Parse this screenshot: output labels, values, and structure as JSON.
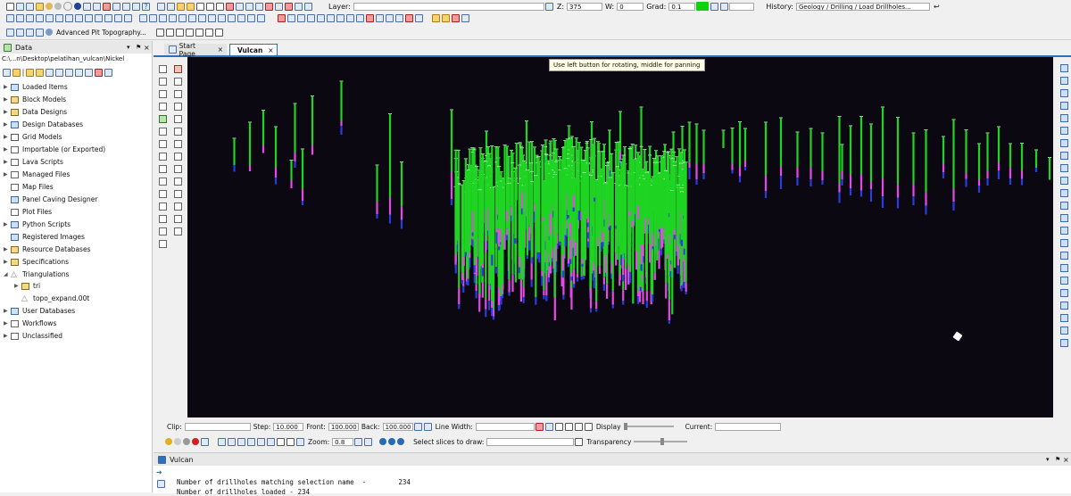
{
  "toolbar": {
    "layer_label": "Layer:",
    "z_label": "Z:",
    "z_value": "375",
    "w_label": "W:",
    "w_value": "0",
    "grad_label": "Grad:",
    "grad_value": "0.1",
    "history_label": "History:",
    "history_value": "Geology / Drilling / Load Drillholes...",
    "advanced_pit_label": "Advanced Pit Topography..."
  },
  "data_panel": {
    "title": "Data",
    "pin_icon": "pin-icon",
    "path": "C:\\...n\\Desktop\\pelatihan_vulcan\\Nickel",
    "items": [
      {
        "label": "Loaded Items",
        "icon": "layers-icon"
      },
      {
        "label": "Block Models",
        "icon": "folder-icon"
      },
      {
        "label": "Data Designs",
        "icon": "folder-icon"
      },
      {
        "label": "Design Databases",
        "icon": "database-icon"
      },
      {
        "label": "Grid Models",
        "icon": "grid-icon"
      },
      {
        "label": "Importable (or Exported)",
        "icon": "file-icon"
      },
      {
        "label": "Lava Scripts",
        "icon": "file-icon"
      },
      {
        "label": "Managed Files",
        "icon": "file-icon"
      },
      {
        "label": "Map Files",
        "icon": "map-icon"
      },
      {
        "label": "Panel Caving Designer",
        "icon": "panel-icon"
      },
      {
        "label": "Plot Files",
        "icon": "plot-icon"
      },
      {
        "label": "Python Scripts",
        "icon": "python-icon"
      },
      {
        "label": "Registered Images",
        "icon": "image-icon"
      },
      {
        "label": "Resource Databases",
        "icon": "folder-icon"
      },
      {
        "label": "Specifications",
        "icon": "folder-icon"
      },
      {
        "label": "Triangulations",
        "icon": "triangle-icon"
      },
      {
        "label": "tri",
        "icon": "folder-icon"
      },
      {
        "label": "topo_expand.00t",
        "icon": "triangle-icon"
      },
      {
        "label": "User Databases",
        "icon": "database-icon"
      },
      {
        "label": "Workflows",
        "icon": "workflow-icon"
      },
      {
        "label": "Unclassified",
        "icon": "file-icon"
      }
    ]
  },
  "tabs": {
    "start_page": "Start Page",
    "vulcan": "Vulcan"
  },
  "viewport": {
    "tooltip": "Use left button for rotating, middle for panning",
    "background": "#0b0811",
    "collar_color": "#ffffff",
    "colors": {
      "green": "#1fd422",
      "magenta": "#e64ae6",
      "blue": "#2a3de0"
    }
  },
  "bottom_toolbar": {
    "clip_label": "Clip:",
    "step_label": "Step:",
    "step_value": "10.000",
    "front_label": "Front:",
    "front_value": "100.000",
    "back_label": "Back:",
    "back_value": "100.000",
    "line_width_label": "Line Width:",
    "display_label": "Display",
    "current_label": "Current:",
    "zoom_label": "Zoom:",
    "zoom_value": "0.8",
    "slices_label": "Select slices to draw:",
    "transparency_label": "Transparency"
  },
  "console": {
    "title": "Vulcan",
    "lines": [
      "Number of drillholes matching selection name  -        234",
      "Number of drillholes loaded - 234"
    ]
  }
}
